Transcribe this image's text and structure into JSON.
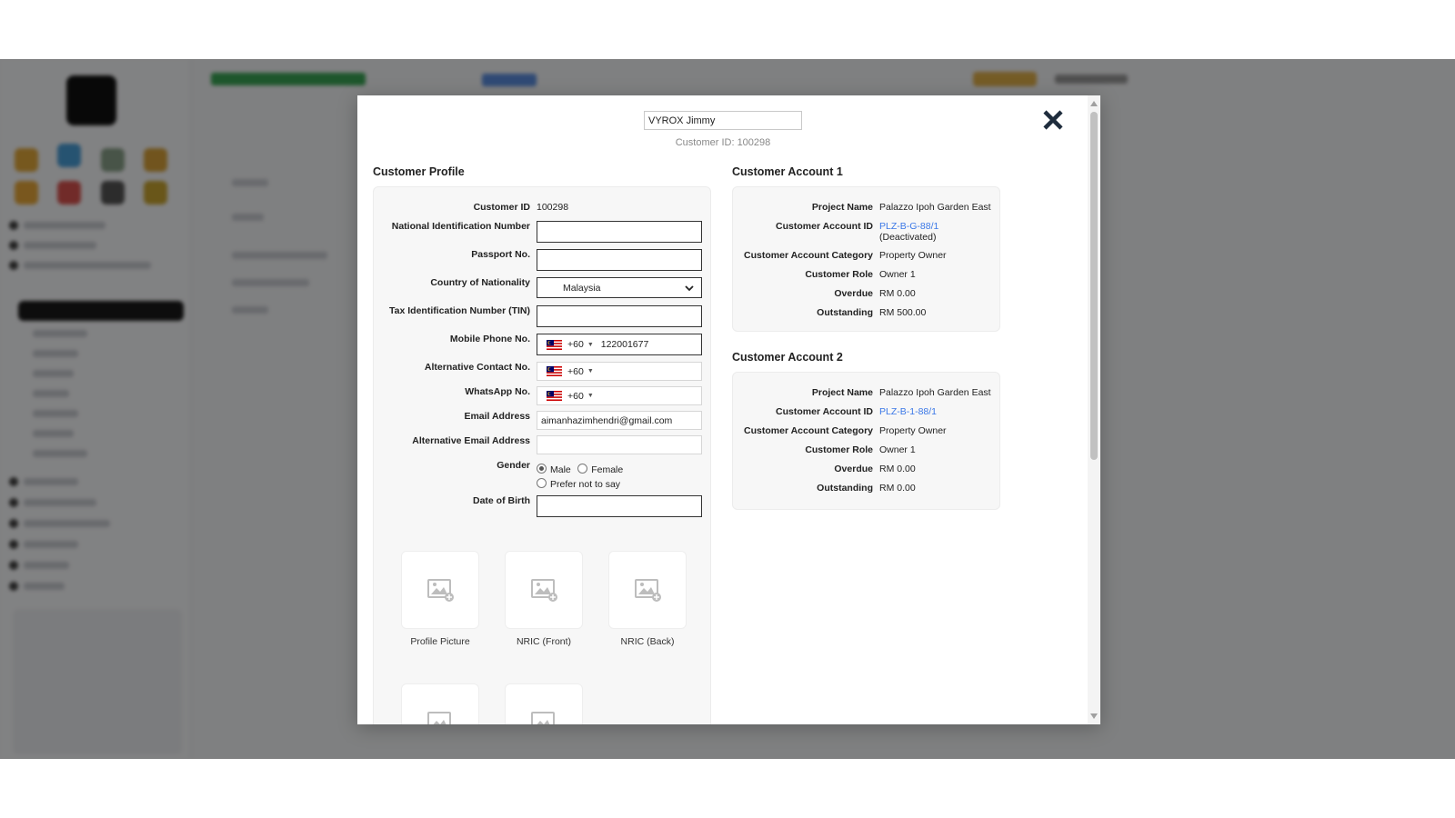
{
  "modal": {
    "customer_name": "VYROX Jimmy",
    "customer_id_caption": "Customer ID: 100298"
  },
  "profile": {
    "section_title": "Customer Profile",
    "fields": {
      "customer_id": {
        "label": "Customer ID",
        "value": "100298"
      },
      "nin": {
        "label": "National Identification Number",
        "value": ""
      },
      "passport": {
        "label": "Passport No.",
        "value": ""
      },
      "nationality": {
        "label": "Country of Nationality",
        "value": "Malaysia"
      },
      "tin": {
        "label": "Tax Identification Number (TIN)",
        "value": ""
      },
      "mobile": {
        "label": "Mobile Phone No.",
        "code": "+60",
        "value": "122001677"
      },
      "alt_contact": {
        "label": "Alternative Contact No.",
        "code": "+60",
        "value": ""
      },
      "whatsapp": {
        "label": "WhatsApp No.",
        "code": "+60",
        "value": ""
      },
      "email": {
        "label": "Email Address",
        "value": "aimanhazimhendri@gmail.com"
      },
      "alt_email": {
        "label": "Alternative Email Address",
        "value": ""
      },
      "gender": {
        "label": "Gender",
        "options": [
          "Male",
          "Female",
          "Prefer not to say"
        ],
        "selected": "Male"
      },
      "dob": {
        "label": "Date of Birth",
        "value": ""
      }
    },
    "images": [
      "Profile Picture",
      "NRIC (Front)",
      "NRIC (Back)"
    ]
  },
  "accounts": [
    {
      "title": "Customer Account 1",
      "labels": {
        "project": "Project Name",
        "account_id": "Customer Account ID",
        "category": "Customer Account Category",
        "role": "Customer Role",
        "overdue": "Overdue",
        "outstanding": "Outstanding"
      },
      "project": "Palazzo Ipoh Garden East",
      "account_id": "PLZ-B-G-88/1",
      "account_status": "(Deactivated)",
      "category": "Property Owner",
      "role": "Owner 1",
      "overdue": "RM 0.00",
      "outstanding": "RM 500.00"
    },
    {
      "title": "Customer Account 2",
      "labels": {
        "project": "Project Name",
        "account_id": "Customer Account ID",
        "category": "Customer Account Category",
        "role": "Customer Role",
        "overdue": "Overdue",
        "outstanding": "Outstanding"
      },
      "project": "Palazzo Ipoh Garden East",
      "account_id": "PLZ-B-1-88/1",
      "category": "Property Owner",
      "role": "Owner 1",
      "overdue": "RM 0.00",
      "outstanding": "RM 0.00"
    }
  ],
  "icons": {
    "close": "close-icon",
    "chevron": "chevron-down-icon",
    "flag": "malaysia-flag-icon",
    "image_placeholder": "image-placeholder-icon"
  },
  "colors": {
    "link": "#3b78e7",
    "panel_bg": "#f7f7f7",
    "close_icon": "#1f2d3d"
  }
}
